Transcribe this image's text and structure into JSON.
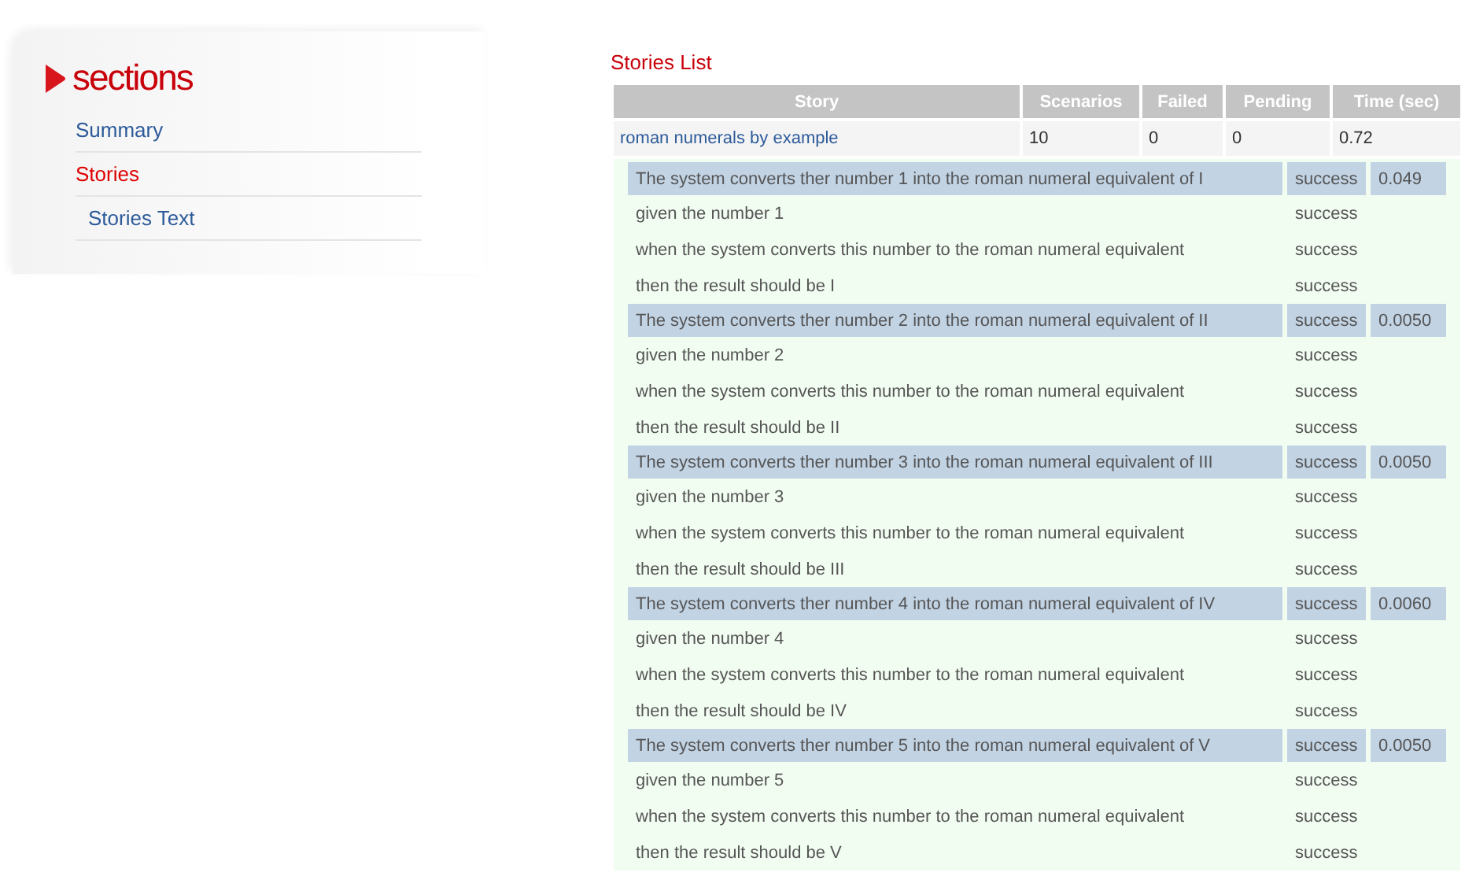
{
  "sidebar": {
    "title": "sections",
    "items": [
      {
        "label": "Summary",
        "selected": false
      },
      {
        "label": "Stories",
        "selected": true,
        "children": [
          {
            "label": "Stories Text",
            "selected": false
          }
        ]
      }
    ]
  },
  "stories_list": {
    "title": "Stories List",
    "columns": [
      "Story",
      "Scenarios",
      "Failed",
      "Pending",
      "Time (sec)"
    ],
    "rows": [
      {
        "story": "roman numerals by example",
        "scenarios": "10",
        "failed": "0",
        "pending": "0",
        "time": "0.72",
        "scenario_results": [
          {
            "title": "The system converts ther number 1 into the roman numeral equivalent of I",
            "status": "success",
            "time": "0.049",
            "steps": [
              {
                "text": "given the number 1",
                "status": "success"
              },
              {
                "text": "when the system converts this number to the roman numeral equivalent",
                "status": "success"
              },
              {
                "text": "then the result should be I",
                "status": "success"
              }
            ]
          },
          {
            "title": "The system converts ther number 2 into the roman numeral equivalent of II",
            "status": "success",
            "time": "0.0050",
            "steps": [
              {
                "text": "given the number 2",
                "status": "success"
              },
              {
                "text": "when the system converts this number to the roman numeral equivalent",
                "status": "success"
              },
              {
                "text": "then the result should be II",
                "status": "success"
              }
            ]
          },
          {
            "title": "The system converts ther number 3 into the roman numeral equivalent of III",
            "status": "success",
            "time": "0.0050",
            "steps": [
              {
                "text": "given the number 3",
                "status": "success"
              },
              {
                "text": "when the system converts this number to the roman numeral equivalent",
                "status": "success"
              },
              {
                "text": "then the result should be III",
                "status": "success"
              }
            ]
          },
          {
            "title": "The system converts ther number 4 into the roman numeral equivalent of IV",
            "status": "success",
            "time": "0.0060",
            "steps": [
              {
                "text": "given the number 4",
                "status": "success"
              },
              {
                "text": "when the system converts this number to the roman numeral equivalent",
                "status": "success"
              },
              {
                "text": "then the result should be IV",
                "status": "success"
              }
            ]
          },
          {
            "title": "The system converts ther number 5 into the roman numeral equivalent of V",
            "status": "success",
            "time": "0.0050",
            "steps": [
              {
                "text": "given the number 5",
                "status": "success"
              },
              {
                "text": "when the system converts this number to the roman numeral equivalent",
                "status": "success"
              },
              {
                "text": "then the result should be V",
                "status": "success"
              }
            ]
          }
        ]
      }
    ]
  }
}
